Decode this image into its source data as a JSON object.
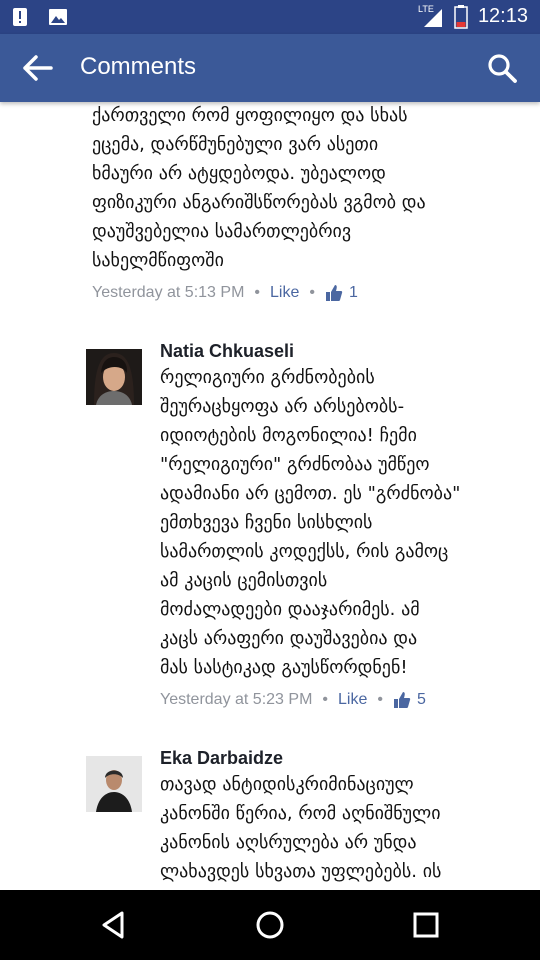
{
  "status_bar": {
    "time": "12:13",
    "network": "LTE",
    "icons": [
      "alert-icon",
      "image-icon",
      "signal-icon",
      "battery-low-icon"
    ],
    "battery_color": "#e53935"
  },
  "app_bar": {
    "title": "Comments",
    "back_icon": "arrow-left-icon",
    "search_icon": "search-icon",
    "color": "#3b5998"
  },
  "comments": [
    {
      "name": "",
      "text": "შეურაცხყოფასთან გვაქვს. ის ბიჭი\nქართველი რომ ყოფილიყო და სხას\nეცემა, დარწმუნებული ვარ ასეთი\nხმაური არ ატყდებოდა. უბეალოდ\nფიზიკური ანგარიშსწორებას ვგმობ და\nდაუშვებელია სამართლებრივ\nსახელმწიფოში",
      "time": "Yesterday at 5:13 PM",
      "like_label": "Like",
      "likes": "1"
    },
    {
      "name": "Natia Chkuaseli",
      "text": "რელიგიური გრძნობების\nშეურაცხყოფა არ არსებობს-\nიდიოტების მოგონილია! ჩემი\n\"რელიგიური\" გრძნობაა უმწეო\nადამიანი არ ცემოთ. ეს \"გრძნობა\"\nემთხვევა ჩვენი სისხლის\nსამართლის კოდექსს, რის გამოც\nამ კაცის ცემისთვის\nმოძალადეები დააჯარიმეს. ამ\nკაცს არაფერი დაუშავებია და\nმას სასტიკად გაუსწორდნენ!",
      "time": "Yesterday at 5:23 PM",
      "like_label": "Like",
      "likes": "5"
    },
    {
      "name": "Eka Darbaidze",
      "text": "თავად ანტიდისკრიმინაციულ\nკანონში წერია, რომ აღნიშნული\nკანონის აღსრულება არ უნდა\nლახავდეს სხვათა უფლებებს. ის\nპალესტინელი ბიჭი უნდა\nდაეჭირათ და პასუხი უნდა ეგო",
      "time": "",
      "like_label": "",
      "likes": ""
    }
  ],
  "nav_bar": {
    "buttons": [
      "back-triangle-icon",
      "home-circle-icon",
      "recents-square-icon"
    ]
  }
}
